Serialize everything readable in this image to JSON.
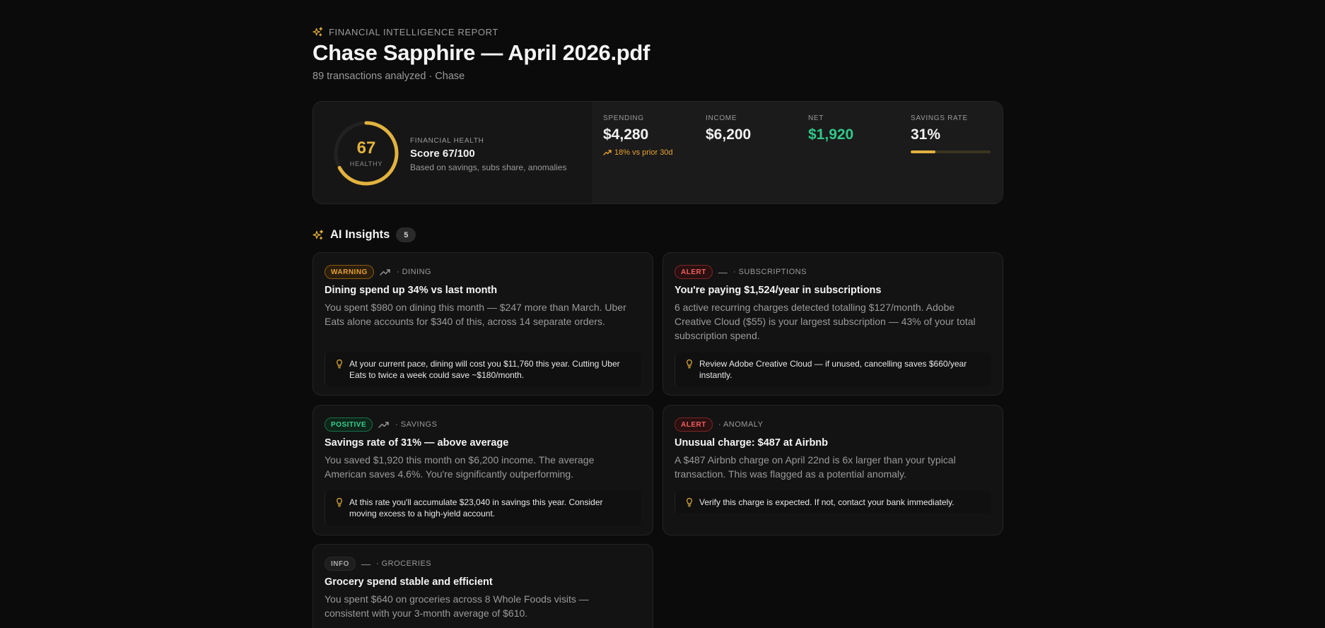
{
  "header": {
    "eyebrow": "FINANCIAL INTELLIGENCE REPORT",
    "title": "Chase Sapphire — April 2026.pdf",
    "subtitle": "89 transactions analyzed · Chase"
  },
  "health": {
    "score": "67",
    "status": "HEALTHY",
    "eyebrow": "FINANCIAL HEALTH",
    "score_text": "Score 67/100",
    "note": "Based on savings, subs share, anomalies",
    "score_fraction": 0.67,
    "ring_color": "#e2b23f"
  },
  "stats": {
    "spending": {
      "label": "SPENDING",
      "value": "$4,280",
      "trend": "18% vs prior 30d"
    },
    "income": {
      "label": "INCOME",
      "value": "$6,200"
    },
    "net": {
      "label": "NET",
      "value": "$1,920",
      "color": "#2fc98a"
    },
    "savings_rate": {
      "label": "SAVINGS RATE",
      "value": "31%",
      "fraction": 0.31
    }
  },
  "insights": {
    "title": "AI Insights",
    "count": "5",
    "cards": [
      {
        "badge": "WARNING",
        "kind": "warning",
        "icon": "trend-up-icon",
        "category": "· DINING",
        "title": "Dining spend up 34% vs last month",
        "body": "You spent $980 on dining this month — $247 more than March. Uber Eats alone accounts for $340 of this, across 14 separate orders.",
        "tip": "At your current pace, dining will cost you $11,760 this year. Cutting Uber Eats to twice a week could save ~$180/month."
      },
      {
        "badge": "ALERT",
        "kind": "alert",
        "icon": "dash",
        "dash": "—",
        "category": "· SUBSCRIPTIONS",
        "title": "You're paying $1,524/year in subscriptions",
        "body": "6 active recurring charges detected totalling $127/month. Adobe Creative Cloud ($55) is your largest subscription — 43% of your total subscription spend.",
        "tip": "Review Adobe Creative Cloud — if unused, cancelling saves $660/year instantly."
      },
      {
        "badge": "POSITIVE",
        "kind": "positive",
        "icon": "trend-up-icon",
        "category": "· SAVINGS",
        "title": "Savings rate of 31% — above average",
        "body": "You saved $1,920 this month on $6,200 income. The average American saves 4.6%. You're significantly outperforming.",
        "tip": "At this rate you'll accumulate $23,040 in savings this year. Consider moving excess to a high-yield account."
      },
      {
        "badge": "ALERT",
        "kind": "alert",
        "icon": "none",
        "category": "· ANOMALY",
        "title": "Unusual charge: $487 at Airbnb",
        "body": "A $487 Airbnb charge on April 22nd is 6x larger than your typical transaction. This was flagged as a potential anomaly.",
        "tip": "Verify this charge is expected. If not, contact your bank immediately."
      },
      {
        "badge": "INFO",
        "kind": "info",
        "icon": "dash",
        "dash": "—",
        "category": "· GROCERIES",
        "title": "Grocery spend stable and efficient",
        "body": "You spent $640 on groceries across 8 Whole Foods visits — consistent with your 3-month average of $610."
      }
    ]
  }
}
